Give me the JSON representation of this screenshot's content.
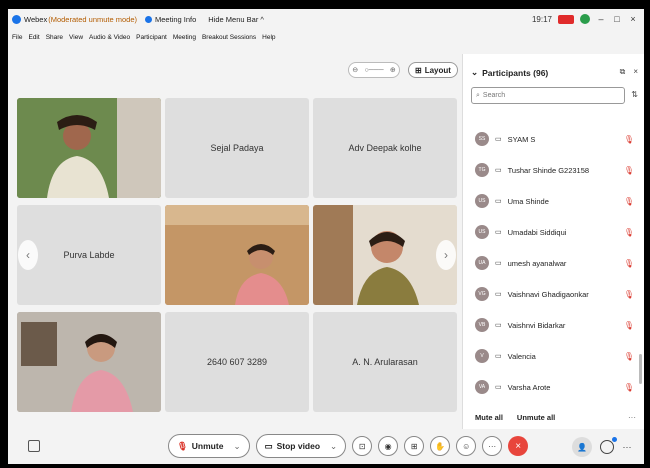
{
  "titlebar": {
    "app_name": "Webex",
    "mode": "(Moderated unmute mode)",
    "meeting_info": "Meeting Info",
    "hide_menu": "Hide Menu Bar ^",
    "time": "19:17"
  },
  "menu": [
    "File",
    "Edit",
    "Share",
    "View",
    "Audio & Video",
    "Participant",
    "Meeting",
    "Breakout Sessions",
    "Help"
  ],
  "layout_button": "Layout",
  "tiles": [
    {
      "name": "",
      "type": "video"
    },
    {
      "name": "Sejal Padaya",
      "type": "name"
    },
    {
      "name": "Adv Deepak kolhe",
      "type": "name"
    },
    {
      "name": "Purva Labde",
      "type": "name"
    },
    {
      "name": "",
      "type": "video"
    },
    {
      "name": "",
      "type": "video"
    },
    {
      "name": "",
      "type": "video"
    },
    {
      "name": "2640 607 3289",
      "type": "name"
    },
    {
      "name": "A. N. Arularasan",
      "type": "name"
    }
  ],
  "participants_panel": {
    "title": "Participants (96)",
    "search_placeholder": "Search",
    "items": [
      {
        "initials": "SS",
        "name": "SYAM S"
      },
      {
        "initials": "TG",
        "name": "Tushar Shinde G223158"
      },
      {
        "initials": "US",
        "name": "Uma Shinde"
      },
      {
        "initials": "US",
        "name": "Umadabi Siddiqui"
      },
      {
        "initials": "UA",
        "name": "umesh ayanalwar"
      },
      {
        "initials": "VG",
        "name": "Vaishnavi Ghadigaonkar"
      },
      {
        "initials": "VB",
        "name": "Vaishnvi Bidarkar"
      },
      {
        "initials": "V",
        "name": "Valencia"
      },
      {
        "initials": "VA",
        "name": "Varsha Arote"
      }
    ],
    "mute_all": "Mute all",
    "unmute_all": "Unmute all"
  },
  "controls": {
    "unmute": "Unmute",
    "stop_video": "Stop video"
  },
  "colors": {
    "accent": "#1a73e8",
    "mute_red": "#d93025",
    "leave_red": "#e8453c"
  }
}
